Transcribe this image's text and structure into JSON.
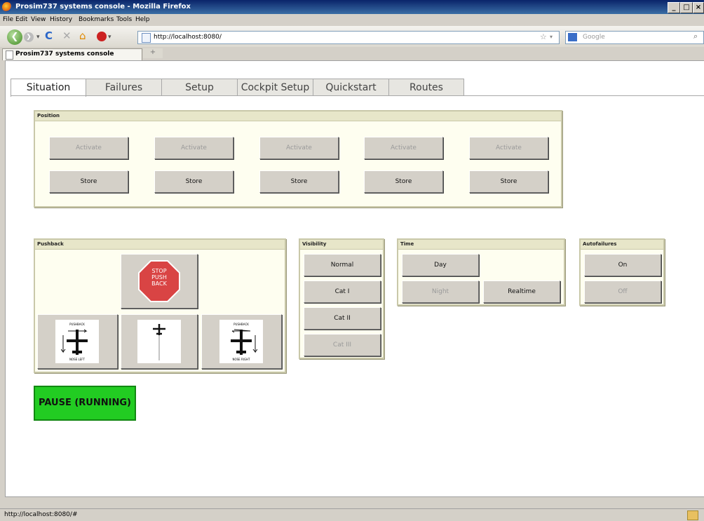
{
  "window": {
    "title": "Prosim737 systems console - Mozilla Firefox",
    "minimize": "_",
    "maximize": "□",
    "close": "×"
  },
  "menu": [
    "File",
    "Edit",
    "View",
    "History",
    "Bookmarks",
    "Tools",
    "Help"
  ],
  "toolbar": {
    "url": "http://localhost:8080/",
    "search_placeholder": "Google"
  },
  "browser_tab": {
    "label": "Prosim737 systems console",
    "new_tab": "+"
  },
  "page_tabs": [
    "Situation",
    "Failures",
    "Setup",
    "Cockpit Setup",
    "Quickstart",
    "Routes"
  ],
  "active_tab": "Situation",
  "position": {
    "title": "Position",
    "activate_label": "Activate",
    "store_label": "Store"
  },
  "pushback": {
    "title": "Pushback",
    "stop_line1": "STOP",
    "stop_line2": "PUSH",
    "stop_line3": "BACK",
    "left_top": "PUSHBACK",
    "left_bottom": "NOSE LEFT",
    "right_top": "PUSHBACK",
    "right_bottom": "NOSE RIGHT"
  },
  "visibility": {
    "title": "Visibility",
    "buttons": [
      "Normal",
      "Cat I",
      "Cat II",
      "Cat III"
    ]
  },
  "time": {
    "title": "Time",
    "day": "Day",
    "night": "Night",
    "realtime": "Realtime"
  },
  "autofailures": {
    "title": "Autofailures",
    "on": "On",
    "off": "Off"
  },
  "pause_label": "PAUSE (RUNNING)",
  "status": {
    "url": "http://localhost:8080/#"
  }
}
